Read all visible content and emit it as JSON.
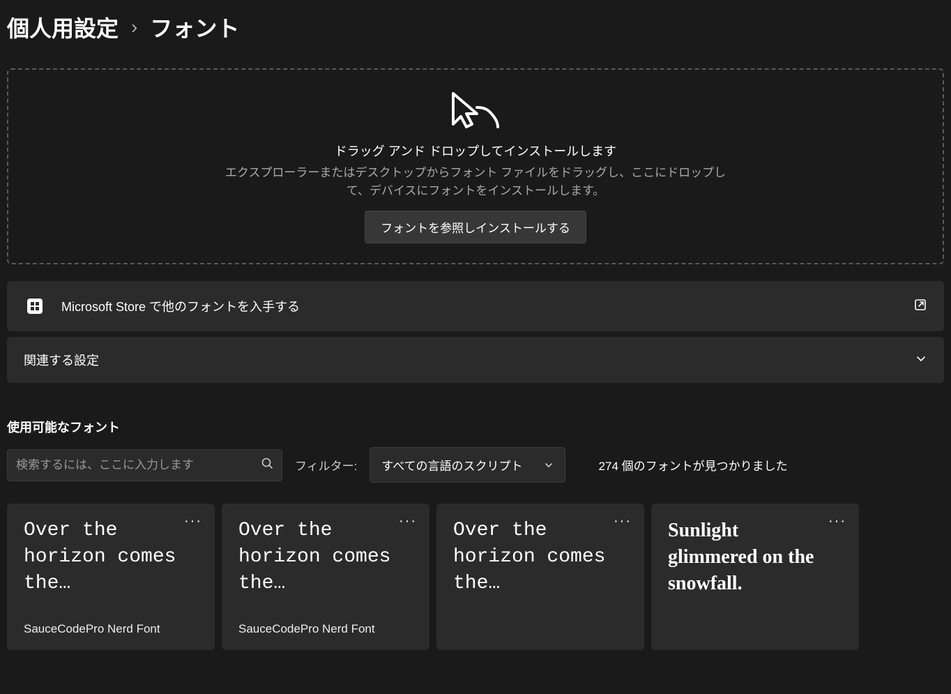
{
  "breadcrumb": {
    "parent": "個人用設定",
    "current": "フォント"
  },
  "dropzone": {
    "title": "ドラッグ アンド ドロップしてインストールします",
    "desc": "エクスプローラーまたはデスクトップからフォント ファイルをドラッグし、ここにドロップして、デバイスにフォントをインストールします。",
    "button": "フォントを参照しインストールする"
  },
  "storeCard": {
    "label": "Microsoft Store で他のフォントを入手する"
  },
  "relatedCard": {
    "label": "関連する設定"
  },
  "availableFonts": {
    "title": "使用可能なフォント",
    "searchPlaceholder": "検索するには、ここに入力します",
    "filterLabel": "フィルター:",
    "filterValue": "すべての言語のスクリプト",
    "foundText": "274 個のフォントが見つかりました"
  },
  "fontCards": [
    {
      "preview": "Over the horizon comes the…",
      "name": "SauceCodePro Nerd Font"
    },
    {
      "preview": "Over the horizon comes the…",
      "name": "SauceCodePro Nerd Font"
    },
    {
      "preview": "Over the horizon comes the…",
      "name": ""
    },
    {
      "preview": "Sunlight glimmered on the snowfall.",
      "name": ""
    }
  ]
}
